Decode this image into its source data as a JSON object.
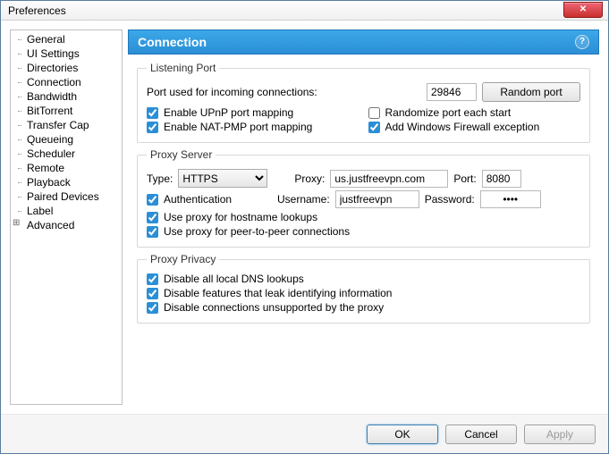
{
  "window": {
    "title": "Preferences"
  },
  "sidebar": {
    "items": [
      "General",
      "UI Settings",
      "Directories",
      "Connection",
      "Bandwidth",
      "BitTorrent",
      "Transfer Cap",
      "Queueing",
      "Scheduler",
      "Remote",
      "Playback",
      "Paired Devices",
      "Label",
      "Advanced"
    ],
    "selected": "Connection"
  },
  "panel": {
    "title": "Connection"
  },
  "listening": {
    "legend": "Listening Port",
    "port_label": "Port used for incoming connections:",
    "port_value": "29846",
    "random_btn": "Random port",
    "upnp": "Enable UPnP port mapping",
    "natpmp": "Enable NAT-PMP port mapping",
    "randomize": "Randomize port each start",
    "firewall": "Add Windows Firewall exception"
  },
  "proxy": {
    "legend": "Proxy Server",
    "type_label": "Type:",
    "type_value": "HTTPS",
    "proxy_label": "Proxy:",
    "proxy_value": "us.justfreevpn.com",
    "port_label": "Port:",
    "port_value": "8080",
    "auth": "Authentication",
    "user_label": "Username:",
    "user_value": "justfreevpn",
    "pass_label": "Password:",
    "pass_value": "••••",
    "hostname": "Use proxy for hostname lookups",
    "p2p": "Use proxy for peer-to-peer connections"
  },
  "privacy": {
    "legend": "Proxy Privacy",
    "dns": "Disable all local DNS lookups",
    "leak": "Disable features that leak identifying information",
    "unsupported": "Disable connections unsupported by the proxy"
  },
  "footer": {
    "ok": "OK",
    "cancel": "Cancel",
    "apply": "Apply"
  }
}
